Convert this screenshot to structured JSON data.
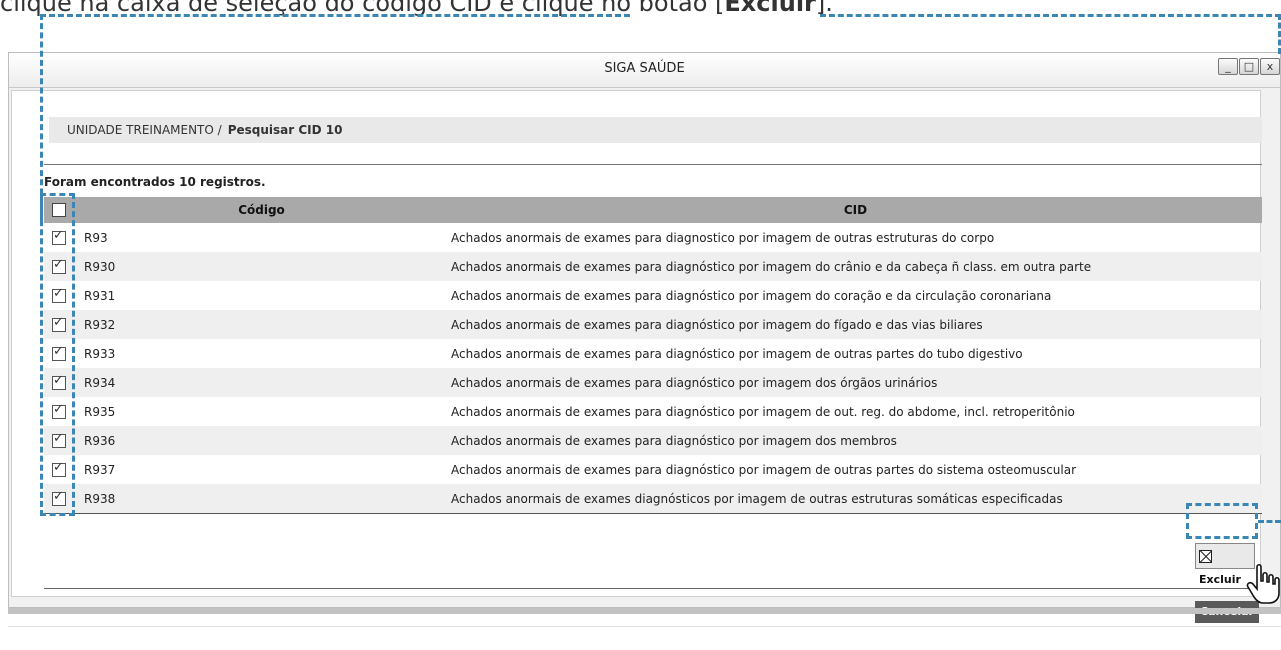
{
  "instruction": {
    "text_start": "clique na caixa de seleção do código CID e clique no botão [",
    "text_bold": "Excluir",
    "text_end": "]."
  },
  "window": {
    "title": "SIGA SAÚDE",
    "controls": [
      "_",
      "□",
      "x"
    ]
  },
  "breadcrumb": {
    "root": "UNIDADE TREINAMENTO /",
    "current": "Pesquisar CID 10"
  },
  "results_text": "Foram encontrados 10 registros.",
  "table": {
    "headers": {
      "code": "Código",
      "cid": "CID"
    },
    "rows": [
      {
        "code": "R93",
        "cid": "Achados anormais de exames para diagnostico por imagem de outras estruturas do corpo",
        "checked": true
      },
      {
        "code": "R930",
        "cid": "Achados anormais de exames para diagnóstico por imagem do crânio e da cabeça ñ class. em outra parte",
        "checked": true
      },
      {
        "code": "R931",
        "cid": "Achados anormais de exames para diagnóstico por imagem do coração e da circulação coronariana",
        "checked": true
      },
      {
        "code": "R932",
        "cid": "Achados anormais de exames para diagnóstico por imagem do fígado e das vias biliares",
        "checked": true
      },
      {
        "code": "R933",
        "cid": "Achados anormais de exames para diagnóstico por imagem de outras partes do tubo digestivo",
        "checked": true
      },
      {
        "code": "R934",
        "cid": "Achados anormais de exames para diagnóstico por imagem dos órgãos urinários",
        "checked": true
      },
      {
        "code": "R935",
        "cid": "Achados anormais de exames para diagnóstico por imagem de out. reg. do abdome, incl. retroperitônio",
        "checked": true
      },
      {
        "code": "R936",
        "cid": "Achados anormais de exames para diagnóstico por imagem dos membros",
        "checked": true
      },
      {
        "code": "R937",
        "cid": "Achados anormais de exames para diagnóstico por imagem de outras partes do sistema osteomuscular",
        "checked": true
      },
      {
        "code": "R938",
        "cid": "Achados anormais de exames diagnósticos por imagem de outras estruturas somáticas especificadas",
        "checked": true
      }
    ]
  },
  "buttons": {
    "delete": "Excluir",
    "cancel": "Cancelar"
  },
  "colors": {
    "highlight": "#3a86b5",
    "header_bg": "#a9a9a9",
    "cancel_bg": "#5a5a5a"
  },
  "icons": {
    "checkbox": "check-icon",
    "delete": "x-box-icon",
    "cursor": "hand-pointer-icon"
  }
}
